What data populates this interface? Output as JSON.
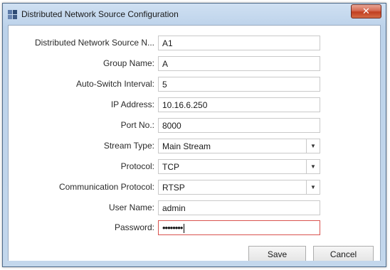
{
  "window": {
    "title": "Distributed Network Source Configuration",
    "close_label": "✕"
  },
  "form": {
    "fields": [
      {
        "label": "Distributed Network Source N...",
        "value": "A1"
      },
      {
        "label": "Group Name:",
        "value": "A"
      },
      {
        "label": "Auto-Switch Interval:",
        "value": "5"
      },
      {
        "label": "IP Address:",
        "value": "10.16.6.250"
      },
      {
        "label": "Port No.:",
        "value": "8000"
      },
      {
        "label": "Stream Type:",
        "value": "Main Stream"
      },
      {
        "label": "Protocol:",
        "value": "TCP"
      },
      {
        "label": "Communication Protocol:",
        "value": "RTSP"
      },
      {
        "label": "User Name:",
        "value": "admin"
      },
      {
        "label": "Password:",
        "value": "••••••••"
      }
    ],
    "dropdown_arrow": "▼"
  },
  "buttons": {
    "save_label": "Save",
    "cancel_label": "Cancel"
  },
  "colors": {
    "focus_border": "#d9534f",
    "close_button": "#c13e20",
    "titlebar": "#bcd2ea"
  }
}
